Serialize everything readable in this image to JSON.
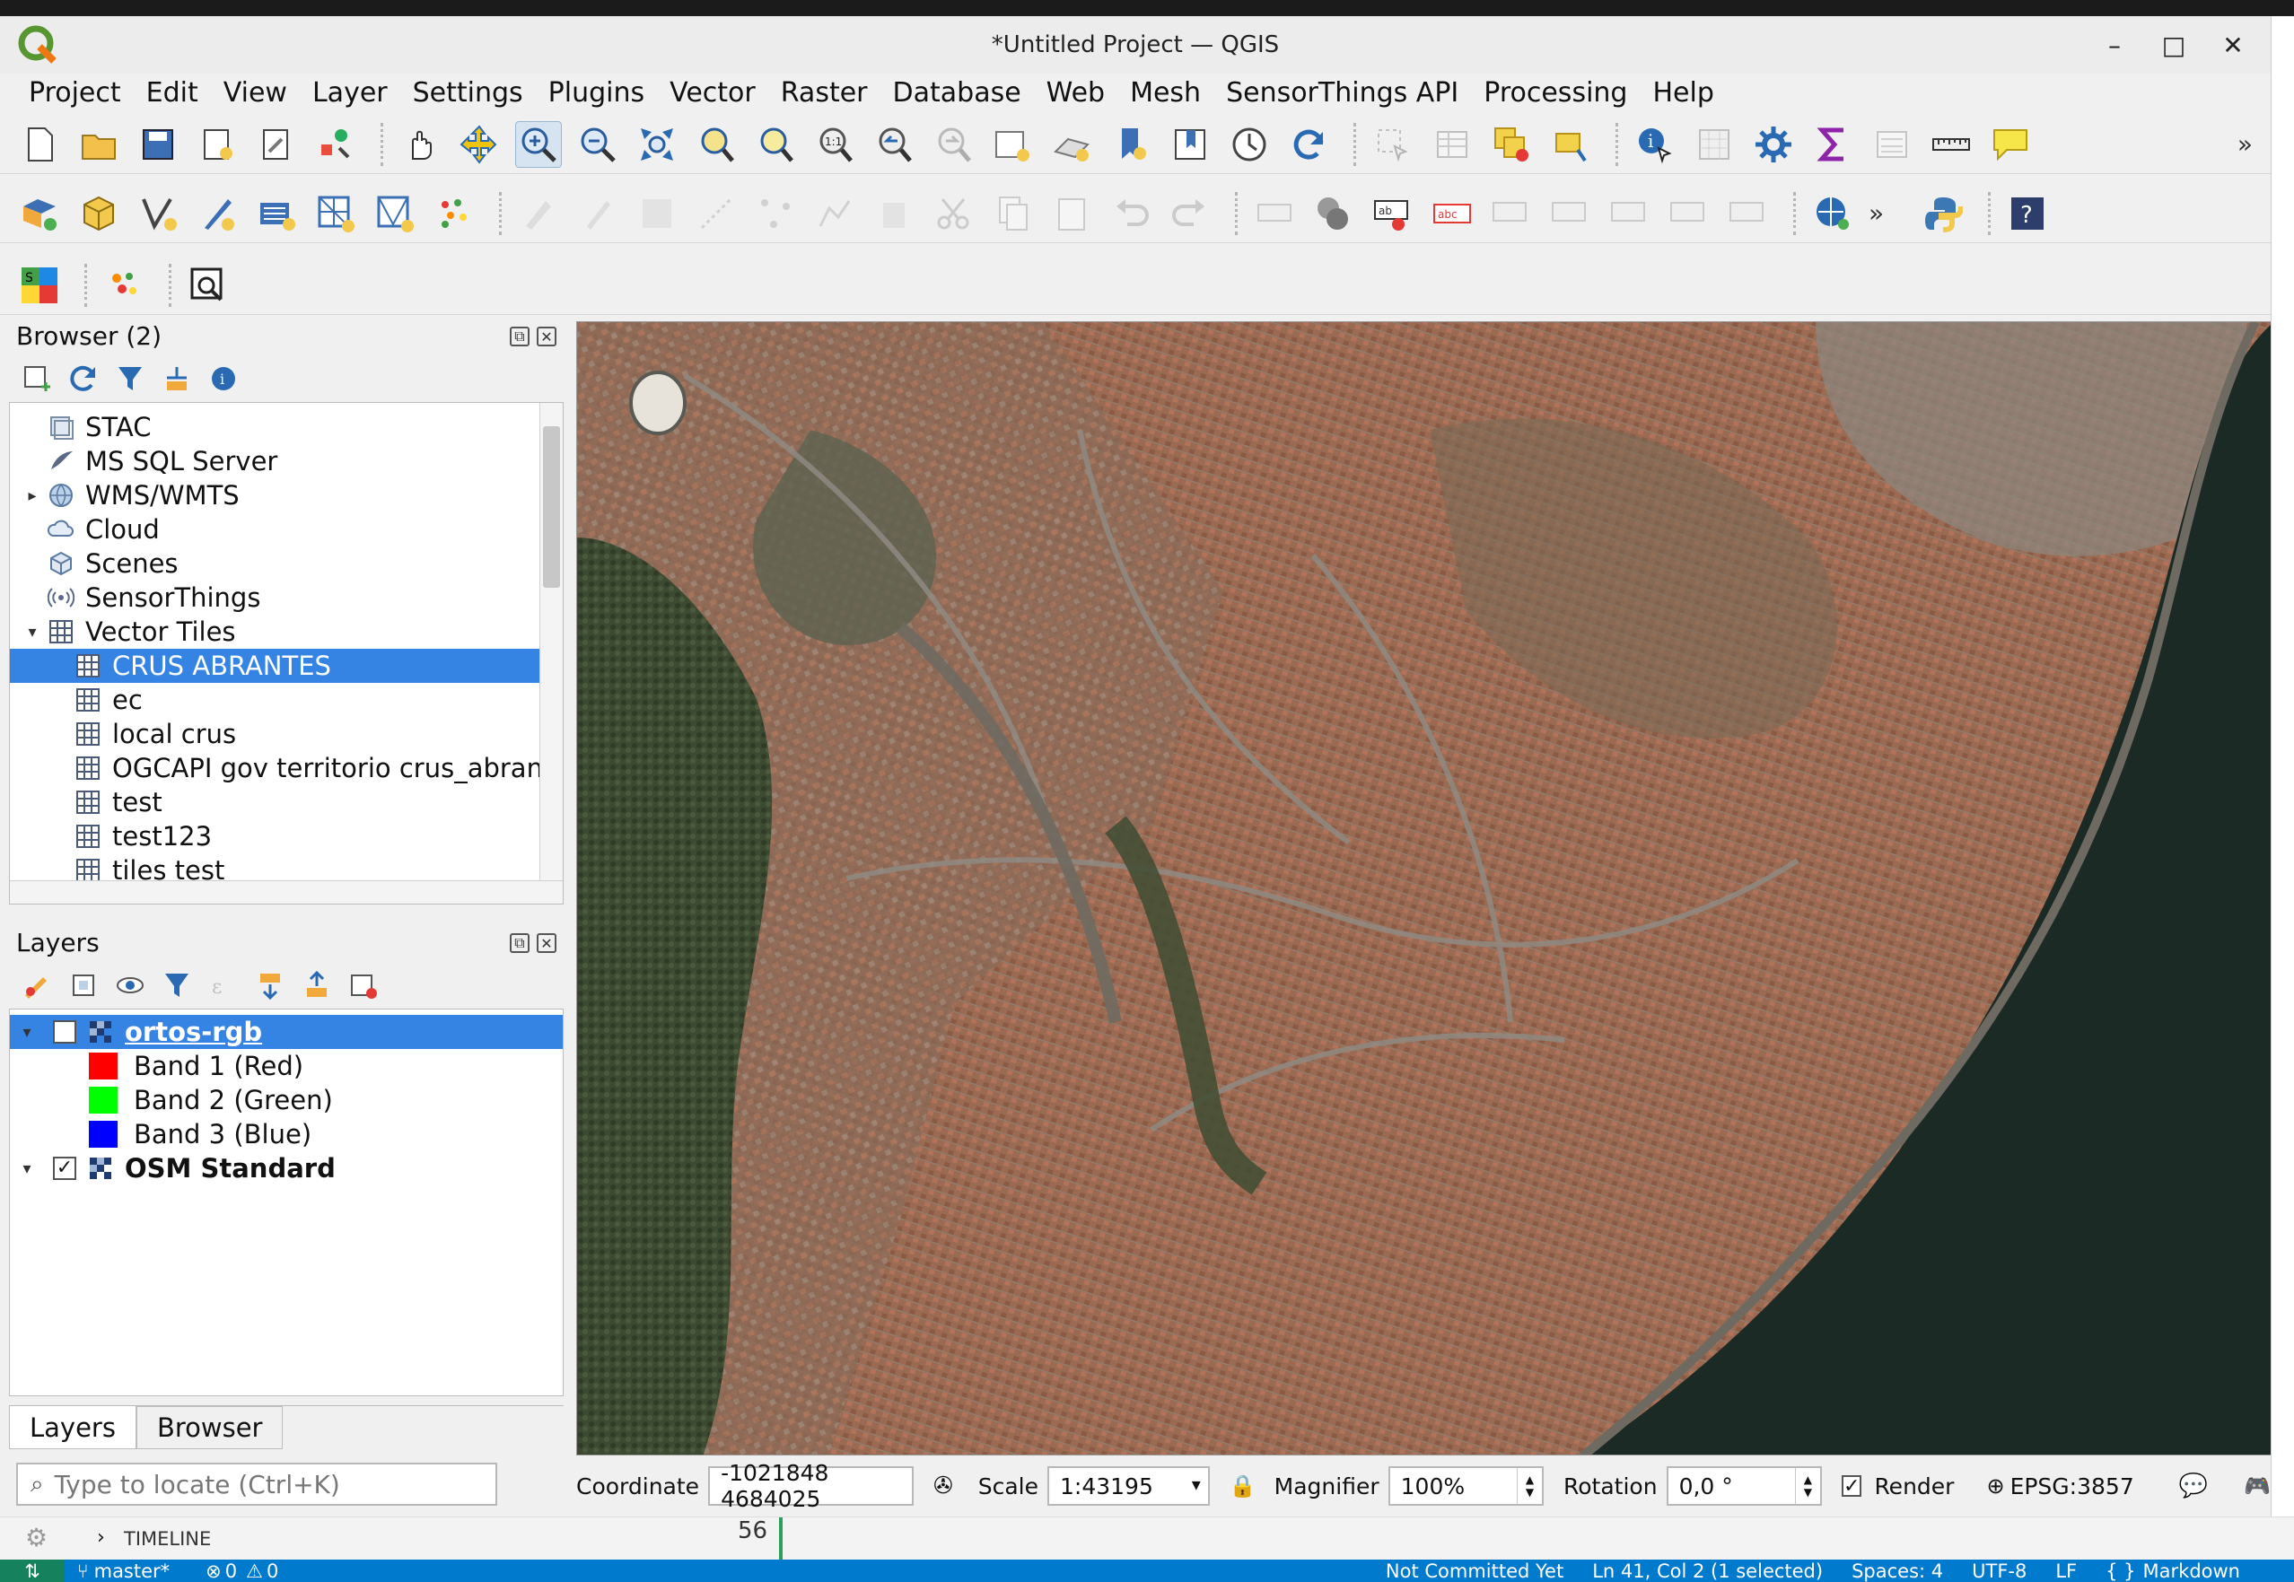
{
  "window": {
    "title": "*Untitled Project — QGIS",
    "controls": [
      "minimize-icon",
      "maximize-icon",
      "close-icon"
    ]
  },
  "menu": [
    "Project",
    "Edit",
    "View",
    "Layer",
    "Settings",
    "Plugins",
    "Vector",
    "Raster",
    "Database",
    "Web",
    "Mesh",
    "SensorThings API",
    "Processing",
    "Help"
  ],
  "browser": {
    "title": "Browser (2)",
    "items": [
      {
        "label": "STAC",
        "icon": "stac-icon",
        "expandable": false,
        "indent": 0
      },
      {
        "label": "MS SQL Server",
        "icon": "mssql-icon",
        "expandable": false,
        "indent": 0
      },
      {
        "label": "WMS/WMTS",
        "icon": "globe-icon",
        "expandable": true,
        "indent": 0
      },
      {
        "label": "Cloud",
        "icon": "cloud-icon",
        "expandable": false,
        "indent": 0
      },
      {
        "label": "Scenes",
        "icon": "cube-icon",
        "expandable": false,
        "indent": 0
      },
      {
        "label": "SensorThings",
        "icon": "sensor-icon",
        "expandable": false,
        "indent": 0
      },
      {
        "label": "Vector Tiles",
        "icon": "grid-icon",
        "expandable": true,
        "expanded": true,
        "indent": 0
      },
      {
        "label": "CRUS ABRANTES",
        "icon": "grid-icon",
        "selected": true,
        "indent": 1
      },
      {
        "label": "ec",
        "icon": "grid-icon",
        "indent": 1
      },
      {
        "label": "local crus",
        "icon": "grid-icon",
        "indent": 1
      },
      {
        "label": "OGCAPI gov territorio crus_abrante",
        "icon": "grid-icon",
        "indent": 1
      },
      {
        "label": "test",
        "icon": "grid-icon",
        "indent": 1
      },
      {
        "label": "test123",
        "icon": "grid-icon",
        "indent": 1
      },
      {
        "label": "tiles test",
        "icon": "grid-icon",
        "indent": 1
      }
    ]
  },
  "layers": {
    "title": "Layers",
    "items": [
      {
        "label": "ortos-rgb",
        "checked": true,
        "selected": true
      },
      {
        "label": "Band 1 (Red)",
        "color": "#ff0000"
      },
      {
        "label": "Band 2 (Green)",
        "color": "#00ff00"
      },
      {
        "label": "Band 3 (Blue)",
        "color": "#0000ff"
      },
      {
        "label": "OSM Standard",
        "checked": true
      }
    ]
  },
  "tabs": [
    "Layers",
    "Browser"
  ],
  "locator": {
    "placeholder": "Type to locate (Ctrl+K)"
  },
  "status": {
    "coordinate_label": "Coordinate",
    "coordinate_value": "-1021848  4684025",
    "scale_label": "Scale",
    "scale_value": "1:43195",
    "magnifier_label": "Magnifier",
    "magnifier_value": "100%",
    "rotation_label": "Rotation",
    "rotation_value": "0,0 °",
    "render_label": "Render",
    "crs": "EPSG:3857"
  },
  "editor": {
    "timeline": "TIMELINE",
    "line_number": "56"
  },
  "vscode_status": {
    "branch": "master*",
    "problems": "0",
    "warnings": "0",
    "commit": "Not Committed Yet",
    "position": "Ln 41, Col 2 (1 selected)",
    "spaces": "Spaces: 4",
    "encoding": "UTF-8",
    "eol": "LF",
    "language": "Markdown"
  }
}
